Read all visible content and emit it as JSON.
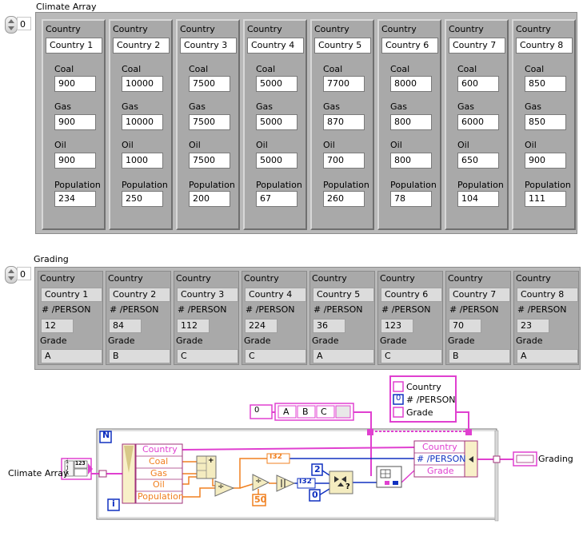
{
  "climate": {
    "title": "Climate Array",
    "index": "0",
    "labels": {
      "country": "Country",
      "coal": "Coal",
      "gas": "Gas",
      "oil": "Oil",
      "population": "Population"
    },
    "items": [
      {
        "country": "Country 1",
        "coal": "900",
        "gas": "900",
        "oil": "900",
        "population": "234"
      },
      {
        "country": "Country 2",
        "coal": "10000",
        "gas": "10000",
        "oil": "1000",
        "population": "250"
      },
      {
        "country": "Country 3",
        "coal": "7500",
        "gas": "7500",
        "oil": "7500",
        "population": "200"
      },
      {
        "country": "Country 4",
        "coal": "5000",
        "gas": "5000",
        "oil": "5000",
        "population": "67"
      },
      {
        "country": "Country 5",
        "coal": "7700",
        "gas": "870",
        "oil": "700",
        "population": "260"
      },
      {
        "country": "Country 6",
        "coal": "8000",
        "gas": "800",
        "oil": "800",
        "population": "78"
      },
      {
        "country": "Country 7",
        "coal": "600",
        "gas": "6000",
        "oil": "650",
        "population": "104"
      },
      {
        "country": "Country 8",
        "coal": "850",
        "gas": "850",
        "oil": "900",
        "population": "111"
      }
    ]
  },
  "grading": {
    "title": "Grading",
    "index": "0",
    "labels": {
      "country": "Country",
      "per_person": "# /PERSON",
      "grade": "Grade"
    },
    "items": [
      {
        "country": "Country 1",
        "per_person": "12",
        "grade": "A"
      },
      {
        "country": "Country 2",
        "per_person": "84",
        "grade": "B"
      },
      {
        "country": "Country 3",
        "per_person": "112",
        "grade": "C"
      },
      {
        "country": "Country 4",
        "per_person": "224",
        "grade": "C"
      },
      {
        "country": "Country 5",
        "per_person": "36",
        "grade": "A"
      },
      {
        "country": "Country 6",
        "per_person": "123",
        "grade": "C"
      },
      {
        "country": "Country 7",
        "per_person": "70",
        "grade": "B"
      },
      {
        "country": "Country 8",
        "per_person": "23",
        "grade": "A"
      }
    ]
  },
  "diagram": {
    "input_label": "Climate Array",
    "output_label": "Grading",
    "loop_n": "N",
    "loop_i": "i",
    "unbundle": [
      "Country",
      "Coal",
      "Gas",
      "Oil",
      "Population"
    ],
    "bundle": [
      "Country",
      "# /PERSON",
      "Grade"
    ],
    "cluster_const": {
      "country": "Country",
      "per_person": "# /PERSON",
      "grade": "Grade",
      "zero": "0"
    },
    "grade_array": {
      "index": "0",
      "items": [
        "A",
        "B",
        "C"
      ]
    },
    "i32_a": "I32",
    "i32_b": "I32",
    "const_50": "50",
    "const_2": "2",
    "const_0": "0",
    "add_sign": "+",
    "div_sign": "÷",
    "compare_sign": "?",
    "colors": {
      "string_wire": "#e040d0",
      "numeric_wire": "#f08020",
      "int_wire": "#1030c0",
      "cluster_wire": "#a0307a"
    }
  }
}
